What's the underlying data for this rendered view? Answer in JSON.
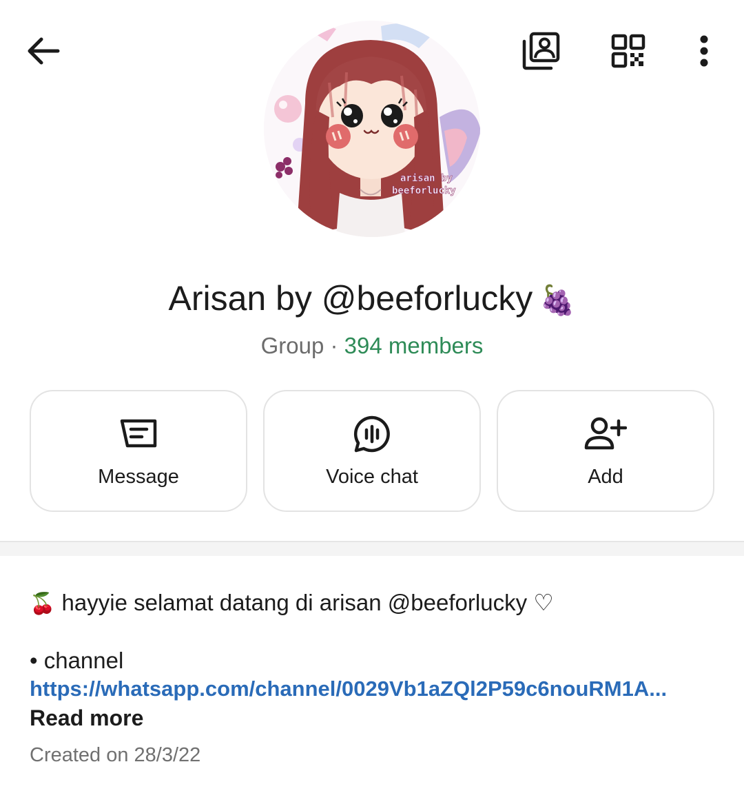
{
  "header": {
    "back_icon": "arrow-left-icon",
    "gallery_icon": "media-gallery-icon",
    "qr_icon": "qr-code-icon",
    "more_icon": "more-vertical-icon"
  },
  "profile": {
    "avatar_text_line1": "arisan by",
    "avatar_text_line2": "beeforlucky",
    "name": "Arisan by @beeforlucky",
    "name_emoji": "🍇",
    "type": "Group",
    "separator": " · ",
    "members": "394 members"
  },
  "actions": [
    {
      "label": "Message",
      "icon": "message-icon"
    },
    {
      "label": "Voice chat",
      "icon": "voice-chat-icon"
    },
    {
      "label": "Add",
      "icon": "add-person-icon"
    }
  ],
  "description": {
    "emoji": "🍒",
    "line1": "hayyie selamat datang di arisan @beeforlucky ♡",
    "line2": "• channel",
    "link": "https://whatsapp.com/channel/0029Vb1aZQl2P59c6nouRM1A...",
    "read_more": "Read more"
  },
  "created": "Created on 28/3/22",
  "colors": {
    "accent_green": "#2e8b57",
    "link_blue": "#2a6bb8"
  }
}
